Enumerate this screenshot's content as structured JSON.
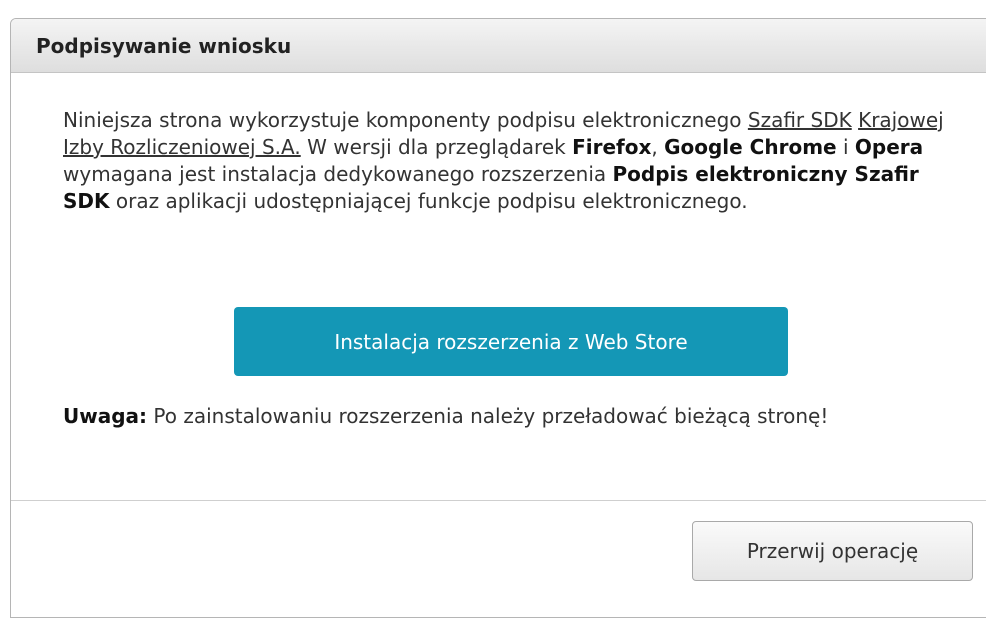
{
  "dialog": {
    "title": "Podpisywanie wniosku",
    "intro": {
      "t1": "Niniejsza strona wykorzystuje komponenty podpisu elektronicznego ",
      "link1": "Szafir SDK",
      "sp1": " ",
      "link2": "Krajowej Izby Rozliczeniowej S.A.",
      "t2": " W wersji dla przeglądarek ",
      "b1": "Firefox",
      "t3": ", ",
      "b2": "Google Chrome",
      "t4": " i ",
      "b3": "Opera",
      "t5": " wymagana jest instalacja dedykowanego rozszerzenia ",
      "b4": "Podpis elektroniczny Szafir SDK",
      "t6": " oraz aplikacji udostępniającej funkcje podpisu elektronicznego."
    },
    "install_button": "Instalacja rozszerzenia z Web Store",
    "note": {
      "label": "Uwaga:",
      "text": " Po zainstalowaniu rozszerzenia należy przeładować bieżącą stronę!"
    },
    "cancel_button": "Przerwij operację"
  },
  "colors": {
    "primary_button": "#1497b6",
    "titlebar_bg": "#e4e4e4"
  }
}
